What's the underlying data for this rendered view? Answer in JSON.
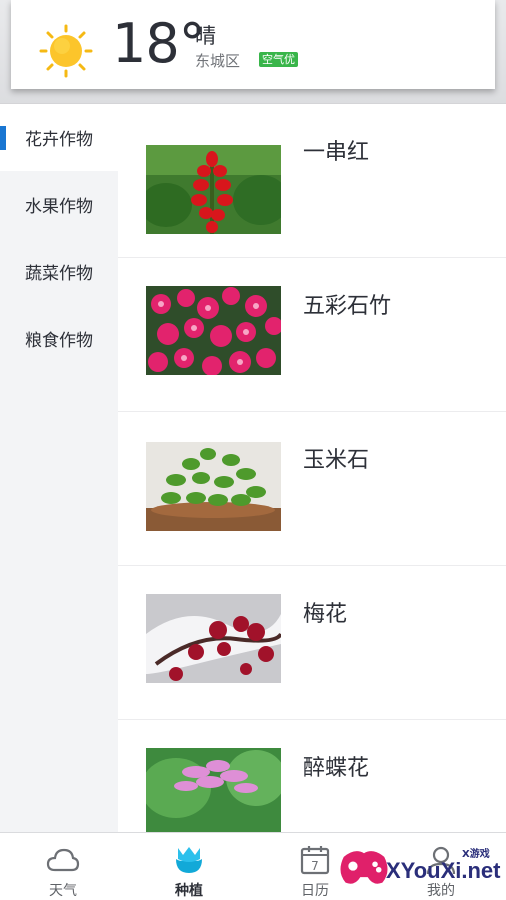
{
  "header": {
    "temperature": "18°",
    "condition": "晴",
    "district": "东城区",
    "air_quality": "空气优",
    "icon": "sun-icon"
  },
  "sidebar": {
    "items": [
      {
        "label": "花卉作物",
        "active": true
      },
      {
        "label": "水果作物",
        "active": false
      },
      {
        "label": "蔬菜作物",
        "active": false
      },
      {
        "label": "粮食作物",
        "active": false
      }
    ]
  },
  "plants": [
    {
      "name": "一串红",
      "image": "salvia-image"
    },
    {
      "name": "五彩石竹",
      "image": "dianthus-image"
    },
    {
      "name": "玉米石",
      "image": "sedum-image"
    },
    {
      "name": "梅花",
      "image": "plum-blossom-image"
    },
    {
      "name": "醉蝶花",
      "image": "cleome-image"
    }
  ],
  "tabs": [
    {
      "label": "天气",
      "icon": "cloud-icon",
      "active": false
    },
    {
      "label": "种植",
      "icon": "tulip-icon",
      "active": true
    },
    {
      "label": "日历",
      "icon": "calendar-icon",
      "active": false
    },
    {
      "label": "我的",
      "icon": "user-icon",
      "active": false
    }
  ],
  "calendar_day": "7",
  "watermark": {
    "text": "XYouXi.net",
    "small": "X游戏"
  },
  "colors": {
    "accent": "#1976d2",
    "aqi_badge": "#39b54a",
    "text": "#2d3038"
  }
}
